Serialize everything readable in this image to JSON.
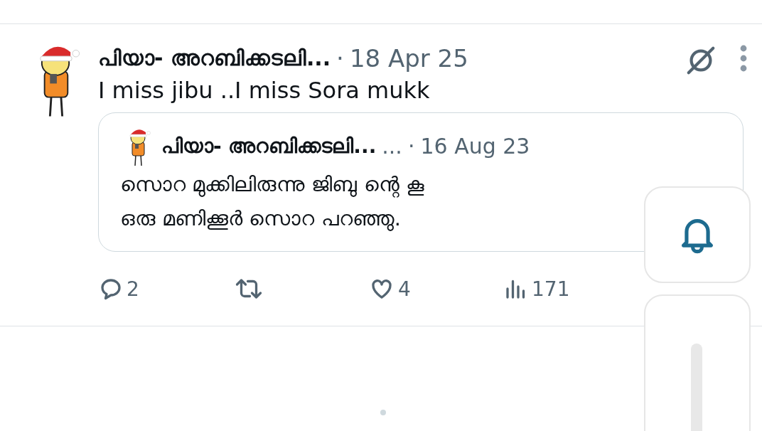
{
  "post": {
    "author": "പിയാ- അറബിക്കടലി...",
    "separator": "·",
    "time": "18 Apr 25",
    "text": "I miss jibu ..I miss Sora mukk",
    "quote": {
      "author": "പിയാ- അറബിക്കടലി...",
      "handle": "...",
      "separator": "·",
      "time": "16 Aug 23",
      "lines": [
        "സൊറ മുക്കിലിരുന്നു ജിബു ന്റെ കൂ",
        "ഒരു മണിക്കൂർ സൊറ പറഞ്ഞു."
      ]
    },
    "actions": [
      {
        "kind": "reply",
        "count": "2"
      },
      {
        "kind": "repost"
      },
      {
        "kind": "like",
        "count": "4"
      },
      {
        "kind": "views",
        "count": "171"
      }
    ]
  }
}
